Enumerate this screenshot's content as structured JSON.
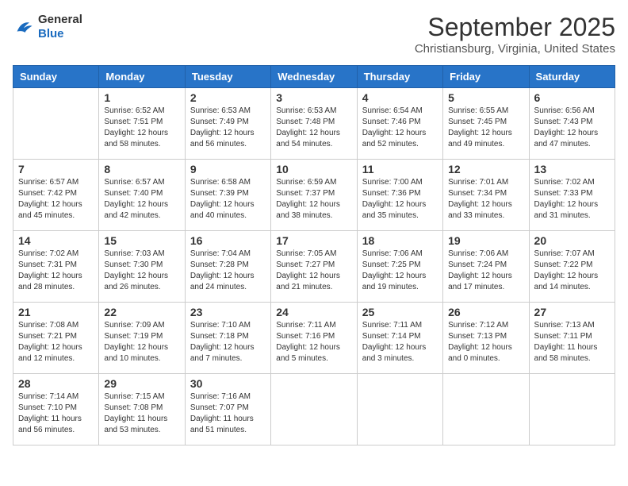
{
  "header": {
    "logo_general": "General",
    "logo_blue": "Blue",
    "month_title": "September 2025",
    "subtitle": "Christiansburg, Virginia, United States"
  },
  "days_of_week": [
    "Sunday",
    "Monday",
    "Tuesday",
    "Wednesday",
    "Thursday",
    "Friday",
    "Saturday"
  ],
  "weeks": [
    [
      {
        "day": "",
        "info": ""
      },
      {
        "day": "1",
        "info": "Sunrise: 6:52 AM\nSunset: 7:51 PM\nDaylight: 12 hours\nand 58 minutes."
      },
      {
        "day": "2",
        "info": "Sunrise: 6:53 AM\nSunset: 7:49 PM\nDaylight: 12 hours\nand 56 minutes."
      },
      {
        "day": "3",
        "info": "Sunrise: 6:53 AM\nSunset: 7:48 PM\nDaylight: 12 hours\nand 54 minutes."
      },
      {
        "day": "4",
        "info": "Sunrise: 6:54 AM\nSunset: 7:46 PM\nDaylight: 12 hours\nand 52 minutes."
      },
      {
        "day": "5",
        "info": "Sunrise: 6:55 AM\nSunset: 7:45 PM\nDaylight: 12 hours\nand 49 minutes."
      },
      {
        "day": "6",
        "info": "Sunrise: 6:56 AM\nSunset: 7:43 PM\nDaylight: 12 hours\nand 47 minutes."
      }
    ],
    [
      {
        "day": "7",
        "info": "Sunrise: 6:57 AM\nSunset: 7:42 PM\nDaylight: 12 hours\nand 45 minutes."
      },
      {
        "day": "8",
        "info": "Sunrise: 6:57 AM\nSunset: 7:40 PM\nDaylight: 12 hours\nand 42 minutes."
      },
      {
        "day": "9",
        "info": "Sunrise: 6:58 AM\nSunset: 7:39 PM\nDaylight: 12 hours\nand 40 minutes."
      },
      {
        "day": "10",
        "info": "Sunrise: 6:59 AM\nSunset: 7:37 PM\nDaylight: 12 hours\nand 38 minutes."
      },
      {
        "day": "11",
        "info": "Sunrise: 7:00 AM\nSunset: 7:36 PM\nDaylight: 12 hours\nand 35 minutes."
      },
      {
        "day": "12",
        "info": "Sunrise: 7:01 AM\nSunset: 7:34 PM\nDaylight: 12 hours\nand 33 minutes."
      },
      {
        "day": "13",
        "info": "Sunrise: 7:02 AM\nSunset: 7:33 PM\nDaylight: 12 hours\nand 31 minutes."
      }
    ],
    [
      {
        "day": "14",
        "info": "Sunrise: 7:02 AM\nSunset: 7:31 PM\nDaylight: 12 hours\nand 28 minutes."
      },
      {
        "day": "15",
        "info": "Sunrise: 7:03 AM\nSunset: 7:30 PM\nDaylight: 12 hours\nand 26 minutes."
      },
      {
        "day": "16",
        "info": "Sunrise: 7:04 AM\nSunset: 7:28 PM\nDaylight: 12 hours\nand 24 minutes."
      },
      {
        "day": "17",
        "info": "Sunrise: 7:05 AM\nSunset: 7:27 PM\nDaylight: 12 hours\nand 21 minutes."
      },
      {
        "day": "18",
        "info": "Sunrise: 7:06 AM\nSunset: 7:25 PM\nDaylight: 12 hours\nand 19 minutes."
      },
      {
        "day": "19",
        "info": "Sunrise: 7:06 AM\nSunset: 7:24 PM\nDaylight: 12 hours\nand 17 minutes."
      },
      {
        "day": "20",
        "info": "Sunrise: 7:07 AM\nSunset: 7:22 PM\nDaylight: 12 hours\nand 14 minutes."
      }
    ],
    [
      {
        "day": "21",
        "info": "Sunrise: 7:08 AM\nSunset: 7:21 PM\nDaylight: 12 hours\nand 12 minutes."
      },
      {
        "day": "22",
        "info": "Sunrise: 7:09 AM\nSunset: 7:19 PM\nDaylight: 12 hours\nand 10 minutes."
      },
      {
        "day": "23",
        "info": "Sunrise: 7:10 AM\nSunset: 7:18 PM\nDaylight: 12 hours\nand 7 minutes."
      },
      {
        "day": "24",
        "info": "Sunrise: 7:11 AM\nSunset: 7:16 PM\nDaylight: 12 hours\nand 5 minutes."
      },
      {
        "day": "25",
        "info": "Sunrise: 7:11 AM\nSunset: 7:14 PM\nDaylight: 12 hours\nand 3 minutes."
      },
      {
        "day": "26",
        "info": "Sunrise: 7:12 AM\nSunset: 7:13 PM\nDaylight: 12 hours\nand 0 minutes."
      },
      {
        "day": "27",
        "info": "Sunrise: 7:13 AM\nSunset: 7:11 PM\nDaylight: 11 hours\nand 58 minutes."
      }
    ],
    [
      {
        "day": "28",
        "info": "Sunrise: 7:14 AM\nSunset: 7:10 PM\nDaylight: 11 hours\nand 56 minutes."
      },
      {
        "day": "29",
        "info": "Sunrise: 7:15 AM\nSunset: 7:08 PM\nDaylight: 11 hours\nand 53 minutes."
      },
      {
        "day": "30",
        "info": "Sunrise: 7:16 AM\nSunset: 7:07 PM\nDaylight: 11 hours\nand 51 minutes."
      },
      {
        "day": "",
        "info": ""
      },
      {
        "day": "",
        "info": ""
      },
      {
        "day": "",
        "info": ""
      },
      {
        "day": "",
        "info": ""
      }
    ]
  ]
}
